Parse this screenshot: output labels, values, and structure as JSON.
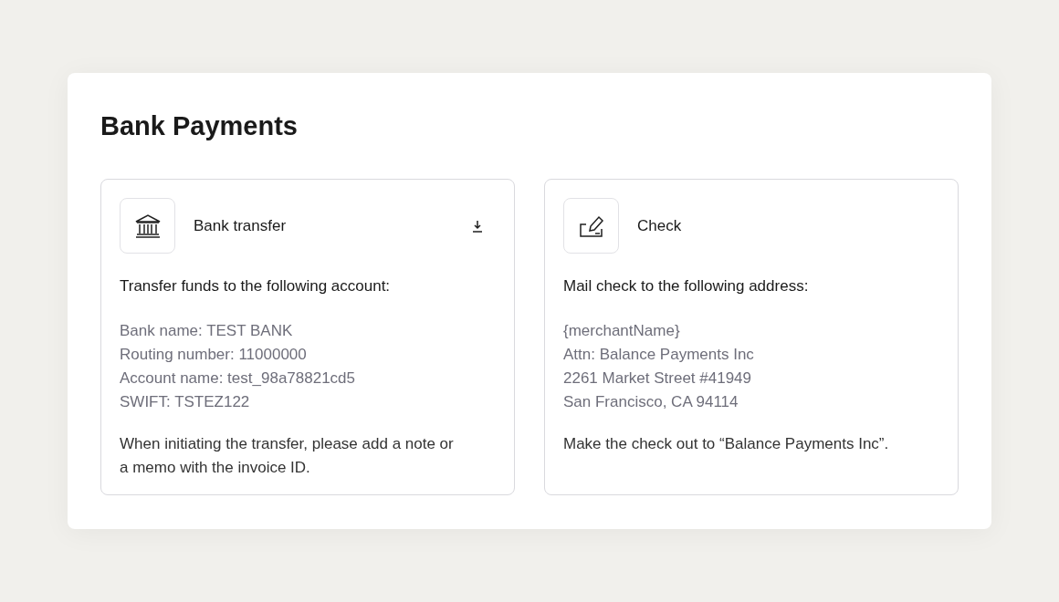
{
  "title": "Bank Payments",
  "methods": [
    {
      "kind": "bank",
      "name": "Bank transfer",
      "downloadable": true,
      "intro": "Transfer funds to the following account:",
      "details": [
        "Bank name: TEST BANK",
        "Routing number: 11000000",
        "Account name: test_98a78821cd5",
        "SWIFT: TSTEZ122"
      ],
      "note": "When initiating the transfer, please add a note or a memo with the invoice ID."
    },
    {
      "kind": "check",
      "name": "Check",
      "downloadable": false,
      "intro": "Mail check to the following address:",
      "details": [
        "{merchantName}",
        "Attn: Balance Payments Inc",
        "2261 Market Street #41949",
        "San Francisco, CA 94114"
      ],
      "note": "Make the check out to “Balance Payments Inc”."
    }
  ]
}
